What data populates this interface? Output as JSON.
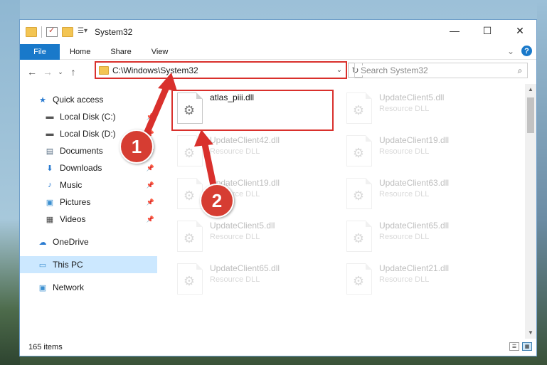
{
  "window": {
    "title": "System32",
    "controls": {
      "minimize": "—",
      "maximize": "☐",
      "close": "✕"
    }
  },
  "ribbon": {
    "tabs": [
      "File",
      "Home",
      "Share",
      "View"
    ],
    "expand": "⌄",
    "help": "?"
  },
  "address": {
    "path": "C:\\Windows\\System32",
    "dropdown": "⌄",
    "refresh": "↻"
  },
  "search": {
    "placeholder": "Search System32",
    "icon": "⌕"
  },
  "nav": {
    "back": "←",
    "forward": "→",
    "recent": "⌄",
    "up": "↑",
    "items": [
      {
        "label": "Quick access",
        "icon": "star-icon",
        "glyph": "★",
        "color": "#2a7bd0"
      },
      {
        "label": "Local Disk (C:)",
        "icon": "drive-icon",
        "glyph": "▬",
        "color": "#555",
        "pinned": true
      },
      {
        "label": "Local Disk (D:)",
        "icon": "drive-icon",
        "glyph": "▬",
        "color": "#555",
        "pinned": true
      },
      {
        "label": "Documents",
        "icon": "document-icon",
        "glyph": "▤",
        "color": "#5a6f85",
        "pinned": true
      },
      {
        "label": "Downloads",
        "icon": "download-icon",
        "glyph": "⬇",
        "color": "#2a7bd0",
        "pinned": true
      },
      {
        "label": "Music",
        "icon": "music-icon",
        "glyph": "♪",
        "color": "#2a7bd0",
        "pinned": true
      },
      {
        "label": "Pictures",
        "icon": "pictures-icon",
        "glyph": "▣",
        "color": "#3b8fd0",
        "pinned": true
      },
      {
        "label": "Videos",
        "icon": "videos-icon",
        "glyph": "▦",
        "color": "#444",
        "pinned": true
      },
      {
        "label": "OneDrive",
        "icon": "cloud-icon",
        "glyph": "☁",
        "color": "#2a7bd0"
      },
      {
        "label": "This PC",
        "icon": "computer-icon",
        "glyph": "▭",
        "color": "#3b8fd0",
        "selected": true
      },
      {
        "label": "Network",
        "icon": "network-icon",
        "glyph": "▣",
        "color": "#3b8fd0"
      }
    ]
  },
  "files": [
    {
      "name": "atlas_piii.dll",
      "type": "",
      "highlighted": true
    },
    {
      "name": "UpdateClient5.dll",
      "type": "Resource DLL"
    },
    {
      "name": "UpdateClient42.dll",
      "type": "Resource DLL"
    },
    {
      "name": "UpdateClient19.dll",
      "type": "Resource DLL"
    },
    {
      "name": "UpdateClient19.dll",
      "type": "Resource DLL"
    },
    {
      "name": "UpdateClient63.dll",
      "type": "Resource DLL"
    },
    {
      "name": "UpdateClient5.dll",
      "type": "Resource DLL"
    },
    {
      "name": "UpdateClient65.dll",
      "type": "Resource DLL"
    },
    {
      "name": "UpdateClient65.dll",
      "type": "Resource DLL"
    },
    {
      "name": "UpdateClient21.dll",
      "type": "Resource DLL"
    }
  ],
  "status": {
    "count": "165 items"
  },
  "annotations": {
    "step1": "1",
    "step2": "2",
    "color": "#d9302c"
  }
}
